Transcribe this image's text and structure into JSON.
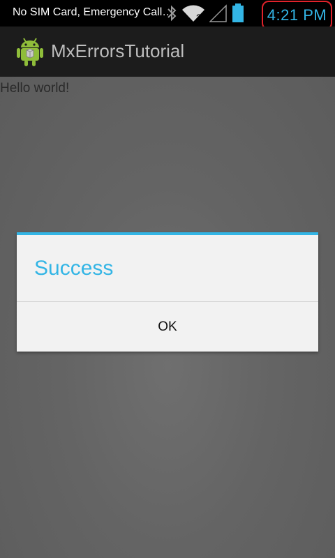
{
  "status_bar": {
    "carrier": "No SIM Card, Emergency Call…",
    "time": "4:21 PM",
    "icons": [
      "bluetooth-icon",
      "wifi-icon",
      "no-signal-icon",
      "battery-icon"
    ]
  },
  "action_bar": {
    "app_icon": "android-icon",
    "title": "MxErrorsTutorial"
  },
  "content": {
    "text": "Hello world!"
  },
  "dialog": {
    "title": "Success",
    "ok_label": "OK"
  },
  "colors": {
    "accent": "#33b5e5",
    "highlight_box": "#e0222a"
  }
}
